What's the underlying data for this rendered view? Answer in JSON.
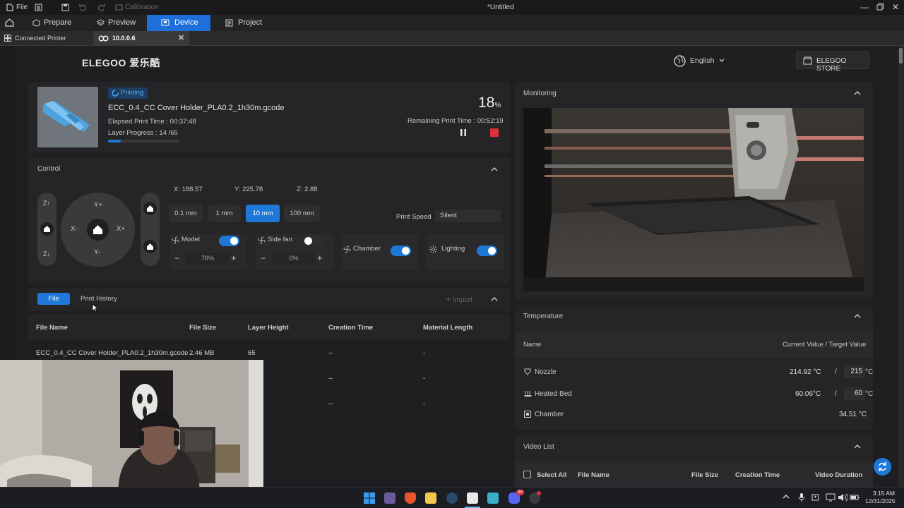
{
  "titlebar": {
    "file_menu": "File",
    "calibration": "Calibration",
    "window_title": "*Untitled"
  },
  "tabs": [
    {
      "label": "Prepare"
    },
    {
      "label": "Preview"
    },
    {
      "label": "Device"
    },
    {
      "label": "Project"
    }
  ],
  "subtabs": {
    "connected_printer": "Connected Printer",
    "device_ip": "10.0.0.6"
  },
  "header": {
    "brand": "ELEGOO 爱乐酷",
    "language": "English",
    "store": "ELEGOO STORE"
  },
  "job": {
    "status": "Printing",
    "filename": "ECC_0.4_CC Cover Holder_PLA0.2_1h30m.gcode",
    "elapsed_label": "Elapsed Print Time :",
    "elapsed_value": "00:37:48",
    "layer_label": "Layer Progress :",
    "layer_value": "14 /65",
    "percent": "18",
    "percent_unit": "%",
    "progress_fraction": 0.18,
    "remaining_label": "Remaining Print Time :",
    "remaining_value": "00:52:19"
  },
  "control": {
    "title": "Control",
    "z_up": "Z↑",
    "z_down": "Z↓",
    "y_plus": "Y+",
    "y_minus": "Y-",
    "x_minus": "X-",
    "x_plus": "X+",
    "x_pos": "X:  188.57",
    "y_pos": "Y:  225.78",
    "z_pos": "Z:  2.88",
    "steps": [
      "0.1 mm",
      "1 mm",
      "10 mm",
      "100 mm"
    ],
    "print_speed_label": "Print Speed",
    "print_speed_value": "Silent",
    "model_fan": "Model",
    "model_fan_value": "76%",
    "side_fan": "Side fan",
    "side_fan_value": "0%",
    "chamber": "Chamber",
    "lighting": "Lighting",
    "minus": "−",
    "plus": "+"
  },
  "files": {
    "tab_file": "File",
    "tab_history": "Print History",
    "import": "Import",
    "columns": [
      "File Name",
      "File Size",
      "Layer Height",
      "Creation Time",
      "Material Length"
    ],
    "rows": [
      [
        "ECC_0.4_CC Cover Holder_PLA0.2_1h30m.gcode",
        "2.46 MB",
        "65",
        "--",
        "-"
      ],
      [
        "",
        "",
        "",
        "--",
        "-"
      ],
      [
        "",
        "",
        "",
        "--",
        "-"
      ]
    ]
  },
  "monitoring": {
    "title": "Monitoring"
  },
  "temperature": {
    "title": "Temperature",
    "col_name": "Name",
    "col_value": "Current Value / Target Value",
    "nozzle_label": "Nozzle",
    "nozzle_current": "214.92 °C",
    "nozzle_target": "215",
    "bed_label": "Heated Bed",
    "bed_current": "60.06°C",
    "bed_target": "60",
    "chamber_label": "Chamber",
    "chamber_current": "34.51 °C",
    "unit": "°C",
    "slash": "/"
  },
  "video_list": {
    "title": "Video List",
    "select_all": "Select All",
    "col_file_name": "File Name",
    "col_file_size": "File Size",
    "col_creation_time": "Creation Time",
    "col_duration": "Video Duration"
  },
  "taskbar": {
    "time": "3:15 AM",
    "date": "12/31/2025",
    "badge": "99"
  },
  "colors": {
    "accent": "#1e78d7",
    "stop": "#e0303a",
    "panel": "#252527"
  }
}
